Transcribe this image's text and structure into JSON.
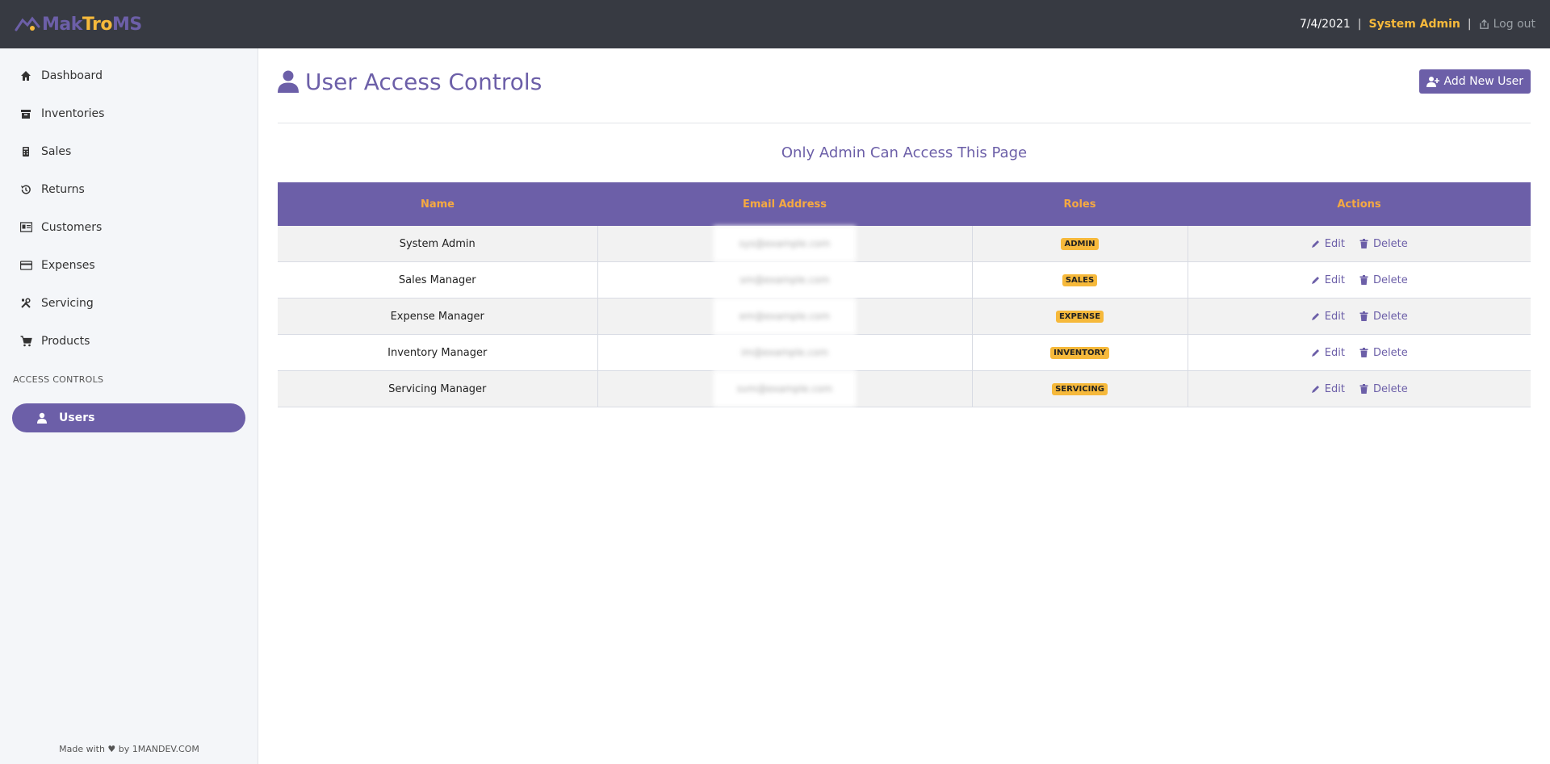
{
  "app": {
    "logo": {
      "part1": "Mak",
      "part2": "Tro",
      "part3": "MS"
    },
    "date": "7/4/2021",
    "separator": "|",
    "user": "System Admin",
    "logout": "Log out"
  },
  "sidebar": {
    "items": [
      {
        "label": "Dashboard",
        "icon": "home-icon"
      },
      {
        "label": "Inventories",
        "icon": "box-icon"
      },
      {
        "label": "Sales",
        "icon": "calculator-icon"
      },
      {
        "label": "Returns",
        "icon": "history-icon"
      },
      {
        "label": "Customers",
        "icon": "id-card-icon"
      },
      {
        "label": "Expenses",
        "icon": "credit-card-icon"
      },
      {
        "label": "Servicing",
        "icon": "tools-icon"
      },
      {
        "label": "Products",
        "icon": "cart-icon"
      }
    ],
    "section_label": "ACCESS CONTROLS",
    "active_item": {
      "label": "Users",
      "icon": "user-icon"
    },
    "footer": "Made with ♥ by 1MANDEV.COM"
  },
  "main": {
    "title": "User Access Controls",
    "add_button": "Add New User",
    "notice": "Only Admin Can Access This Page",
    "table": {
      "headers": [
        "Name",
        "Email Address",
        "Roles",
        "Actions"
      ],
      "rows": [
        {
          "name": "System Admin",
          "email": "sys@example.com",
          "role": "ADMIN"
        },
        {
          "name": "Sales Manager",
          "email": "sm@example.com",
          "role": "SALES"
        },
        {
          "name": "Expense Manager",
          "email": "em@example.com",
          "role": "EXPENSE"
        },
        {
          "name": "Inventory Manager",
          "email": "im@example.com",
          "role": "INVENTORY"
        },
        {
          "name": "Servicing Manager",
          "email": "svm@example.com",
          "role": "SERVICING"
        }
      ],
      "edit_label": "Edit",
      "delete_label": "Delete"
    }
  },
  "colors": {
    "accent": "#6c5fa8",
    "highlight": "#f6b93b",
    "topbar": "#373a42"
  }
}
